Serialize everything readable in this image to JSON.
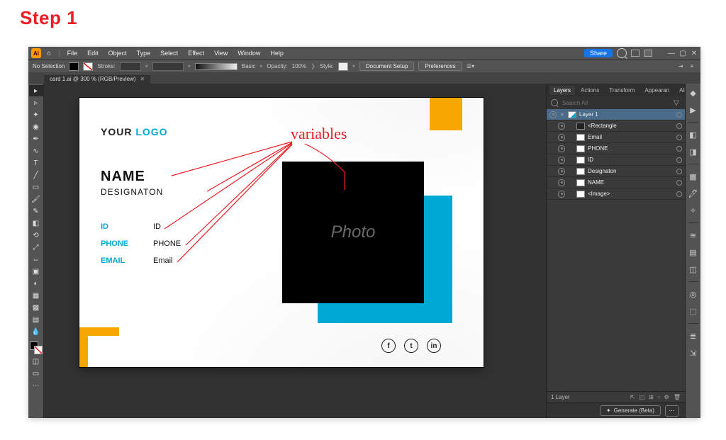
{
  "step_label": "Step 1",
  "menubar": {
    "items": [
      "File",
      "Edit",
      "Object",
      "Type",
      "Select",
      "Effect",
      "View",
      "Window",
      "Help"
    ],
    "share": "Share"
  },
  "control": {
    "selection": "No Selection",
    "stroke_label": "Stroke:",
    "basic_label": "Basic",
    "opacity_label": "Opacity:",
    "opacity_value": "100%",
    "style_label": "Style:",
    "doc_setup": "Document Setup",
    "preferences": "Preferences"
  },
  "doc_tab": {
    "title": "card 1.ai @ 300 % (RGB/Preview)"
  },
  "artboard": {
    "logo_a": "YOUR ",
    "logo_b": "LOGO",
    "name": "NAME",
    "designation": "DESIGNATON",
    "id_label": "ID",
    "id_value": "ID",
    "phone_label": "PHONE",
    "phone_value": "PHONE",
    "email_label": "EMAIL",
    "email_value": "Email",
    "photo_placeholder": "Photo",
    "annotation": "variables",
    "social": {
      "fb": "f",
      "tw": "t",
      "in": "in"
    }
  },
  "layers_panel": {
    "tabs": [
      "Layers",
      "Actions",
      "Transform",
      "Appearan",
      "Align"
    ],
    "search_placeholder": "Search All",
    "rows": [
      {
        "name": "Layer 1",
        "top": true
      },
      {
        "name": "<Rectangle"
      },
      {
        "name": "Email"
      },
      {
        "name": "PHONE"
      },
      {
        "name": "ID"
      },
      {
        "name": "Designaton"
      },
      {
        "name": "NAME"
      },
      {
        "name": "<Image>"
      }
    ],
    "status": "1 Layer",
    "generate": "Generate (Beta)"
  }
}
